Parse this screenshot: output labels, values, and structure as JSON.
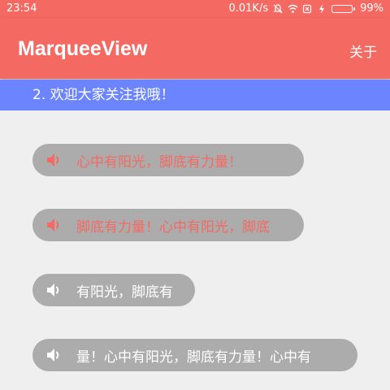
{
  "status_bar": {
    "time": "23:54",
    "network_speed": "0.01K/s",
    "battery_percent": "99%",
    "battery_level": 0.99
  },
  "app_bar": {
    "title": "MarqueeView",
    "about_label": "关于"
  },
  "top_marquee": {
    "text": "2. 欢迎大家关注我哦！"
  },
  "marquees": [
    {
      "text": "心中有阳光，脚底有力量！",
      "color": "#f46a62",
      "icon": "speaker-icon"
    },
    {
      "text": "脚底有力量！心中有阳光，脚底",
      "color": "#f46a62",
      "icon": "speaker-icon"
    },
    {
      "text": "有阳光，脚底有",
      "color": "#ffffff",
      "icon": "speaker-icon"
    },
    {
      "text": "量！心中有阳光，脚底有力量！心中有",
      "color": "#ffffff",
      "icon": "speaker-icon"
    }
  ],
  "colors": {
    "primary": "#f46a62",
    "top_marquee_bg": "#6c85ff",
    "pill_bg": "#acacac",
    "page_bg": "#efefef"
  }
}
